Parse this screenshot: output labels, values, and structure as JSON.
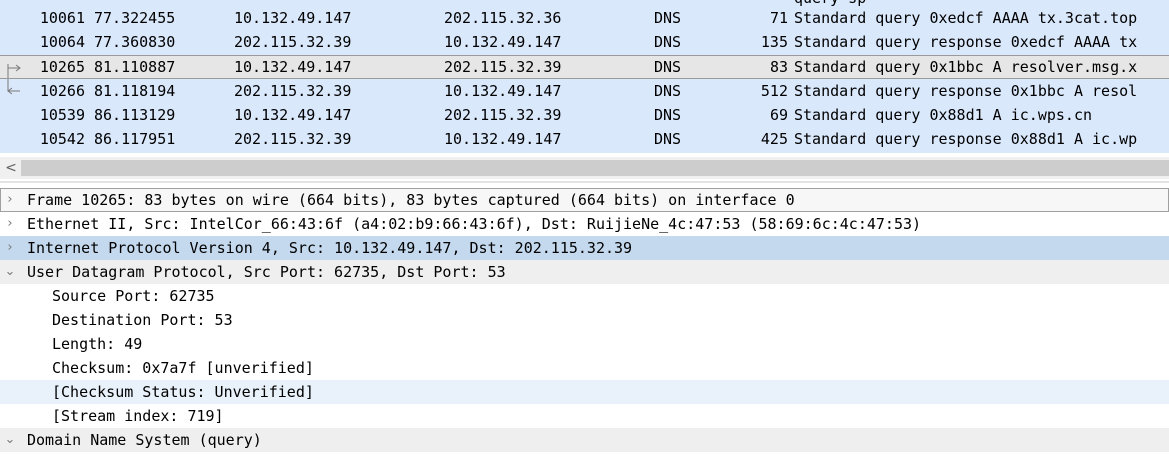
{
  "packet_list": {
    "partial_row": {
      "time_fragment": "",
      "info_fragment": "query    sp"
    },
    "rows": [
      {
        "no": "10061",
        "time": "77.322455",
        "src": "10.132.49.147",
        "dst": "202.115.32.36",
        "proto": "DNS",
        "len": "71",
        "info": "Standard query 0xedcf AAAA tx.3cat.top"
      },
      {
        "no": "10064",
        "time": "77.360830",
        "src": "202.115.32.39",
        "dst": "10.132.49.147",
        "proto": "DNS",
        "len": "135",
        "info": "Standard query response 0xedcf AAAA tx"
      },
      {
        "no": "10265",
        "time": "81.110887",
        "src": "10.132.49.147",
        "dst": "202.115.32.39",
        "proto": "DNS",
        "len": "83",
        "info": "Standard query 0x1bbc A resolver.msg.x"
      },
      {
        "no": "10266",
        "time": "81.118194",
        "src": "202.115.32.39",
        "dst": "10.132.49.147",
        "proto": "DNS",
        "len": "512",
        "info": "Standard query response 0x1bbc A resol"
      },
      {
        "no": "10539",
        "time": "86.113129",
        "src": "10.132.49.147",
        "dst": "202.115.32.39",
        "proto": "DNS",
        "len": "69",
        "info": "Standard query 0x88d1 A ic.wps.cn"
      },
      {
        "no": "10542",
        "time": "86.117951",
        "src": "202.115.32.39",
        "dst": "10.132.49.147",
        "proto": "DNS",
        "len": "425",
        "info": "Standard query response 0x88d1 A ic.wp"
      }
    ],
    "selected_index": 2,
    "colors": {
      "row_bg": "#dae8fc",
      "selected_bg": "#e6e6e6"
    }
  },
  "scrollbar": {
    "left_arrow": "<"
  },
  "details": {
    "items": [
      {
        "text": "Frame 10265: 83 bytes on wire (664 bits), 83 bytes captured (664 bits) on interface 0",
        "expander": "chevron-right-icon"
      },
      {
        "text": "Ethernet II, Src: IntelCor_66:43:6f (a4:02:b9:66:43:6f), Dst: RuijieNe_4c:47:53 (58:69:6c:4c:47:53)",
        "expander": "chevron-right-icon"
      },
      {
        "text": "Internet Protocol Version 4, Src: 10.132.49.147, Dst: 202.115.32.39",
        "expander": "chevron-right-icon"
      },
      {
        "text": "User Datagram Protocol, Src Port: 62735, Dst Port: 53",
        "expander": "chevron-down-icon"
      },
      {
        "text": "Source Port: 62735"
      },
      {
        "text": "Destination Port: 53"
      },
      {
        "text": "Length: 49"
      },
      {
        "text": "Checksum: 0x7a7f [unverified]"
      },
      {
        "text": "[Checksum Status: Unverified]"
      },
      {
        "text": "[Stream index: 719]"
      },
      {
        "text": "Domain Name System (query)",
        "expander": "chevron-down-icon"
      }
    ],
    "colors": {
      "selected_bg": "#c4d9ee",
      "alt_bg": "#efefef"
    }
  }
}
